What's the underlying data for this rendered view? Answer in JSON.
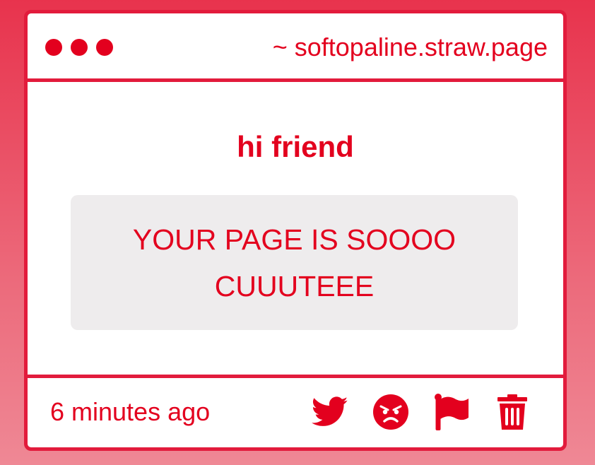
{
  "titlebar": {
    "url": "~ softopaline.straw.page"
  },
  "post": {
    "greeting": "hi friend",
    "message": "YOUR PAGE IS SOOOO CUUUTEEE"
  },
  "footer": {
    "timestamp": "6 minutes ago",
    "actions": [
      "twitter-icon",
      "angry-face-icon",
      "flag-icon",
      "trash-icon"
    ]
  },
  "colors": {
    "accent": "#e3001e",
    "card_border": "#e21b3c",
    "message_bg": "#eeeced",
    "background_top": "#e8334d",
    "background_bottom": "#ef8895"
  }
}
